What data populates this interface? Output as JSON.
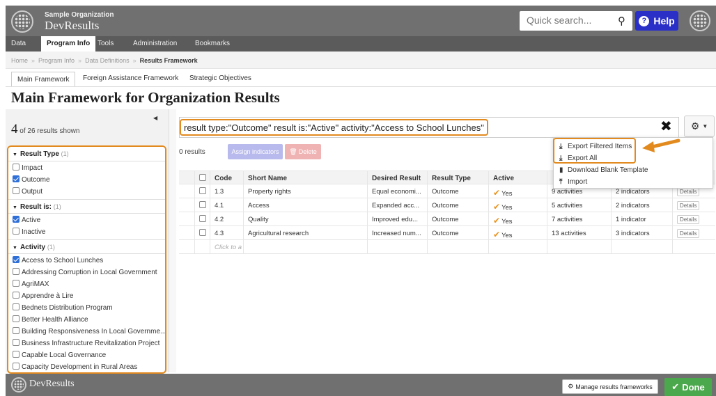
{
  "header": {
    "org_name": "Sample Organization",
    "app_name": "DevResults",
    "search_placeholder": "Quick search...",
    "help_label": "Help"
  },
  "nav": {
    "items": [
      "Data",
      "Program Info",
      "Tools",
      "Administration",
      "Bookmarks"
    ],
    "active": "Program Info"
  },
  "breadcrumb": {
    "items": [
      "Home",
      "Program Info",
      "Data Definitions"
    ],
    "current": "Results Framework"
  },
  "tabs": [
    "Main Framework",
    "Foreign Assistance Framework",
    "Strategic Objectives"
  ],
  "page_title": "Main Framework for Organization Results",
  "left_pane": {
    "count_number": "4",
    "count_text": "of 26 results shown",
    "facets": [
      {
        "title": "Result Type",
        "count": "(1)",
        "options": [
          {
            "label": "Impact",
            "checked": false
          },
          {
            "label": "Outcome",
            "checked": true
          },
          {
            "label": "Output",
            "checked": false
          }
        ]
      },
      {
        "title": "Result is:",
        "count": "(1)",
        "options": [
          {
            "label": "Active",
            "checked": true
          },
          {
            "label": "Inactive",
            "checked": false
          }
        ]
      },
      {
        "title": "Activity",
        "count": "(1)",
        "options": [
          {
            "label": "Access to School Lunches",
            "checked": true
          },
          {
            "label": "Addressing Corruption in Local Government",
            "checked": false
          },
          {
            "label": "AgriMAX",
            "checked": false
          },
          {
            "label": "Apprendre à Lire",
            "checked": false
          },
          {
            "label": "Bednets Distribution Program",
            "checked": false
          },
          {
            "label": "Better Health Alliance",
            "checked": false
          },
          {
            "label": "Building Responsiveness In Local Governme...",
            "checked": false
          },
          {
            "label": "Business Infrastructure Revitalization Project",
            "checked": false
          },
          {
            "label": "Capable Local Governance",
            "checked": false
          },
          {
            "label": "Capacity Development in Rural Areas",
            "checked": false
          }
        ]
      }
    ]
  },
  "filter": {
    "query": "result type:\"Outcome\" result is:\"Active\" activity:\"Access to School Lunches\""
  },
  "toolbar": {
    "result_count": "0 results",
    "assign_label": "Assign indicators",
    "delete_label": "Delete"
  },
  "table": {
    "columns": [
      "Code",
      "Short Name",
      "Desired Result",
      "Result Type",
      "Active"
    ],
    "rows": [
      {
        "code": "1.3",
        "name": "Property rights",
        "desired": "Equal economi...",
        "type": "Outcome",
        "active": "Yes",
        "activities": "9 activities",
        "indicators": "2 indicators",
        "details": "Details"
      },
      {
        "code": "4.1",
        "name": "Access",
        "desired": "Expanded acc...",
        "type": "Outcome",
        "active": "Yes",
        "activities": "5 activities",
        "indicators": "2 indicators",
        "details": "Details"
      },
      {
        "code": "4.2",
        "name": "Quality",
        "desired": "Improved edu...",
        "type": "Outcome",
        "active": "Yes",
        "activities": "7 activities",
        "indicators": "1 indicator",
        "details": "Details"
      },
      {
        "code": "4.3",
        "name": "Agricultural research",
        "desired": "Increased num...",
        "type": "Outcome",
        "active": "Yes",
        "activities": "13 activities",
        "indicators": "3 indicators",
        "details": "Details"
      }
    ],
    "add_placeholder": "Click to a"
  },
  "menu": {
    "items": [
      {
        "label": "Export Filtered Items",
        "icon": "download-icon"
      },
      {
        "label": "Export All",
        "icon": "download-icon"
      },
      {
        "label": "Download Blank Template",
        "icon": "file-icon"
      },
      {
        "label": "Import",
        "icon": "upload-icon"
      }
    ]
  },
  "footer": {
    "app_name": "DevResults",
    "manage_label": "Manage results frameworks",
    "done_label": "Done"
  },
  "colors": {
    "highlight": "#e28a1e",
    "help": "#2a2fc7",
    "done": "#4ca84c",
    "checkbox": "#2f6fd8"
  }
}
